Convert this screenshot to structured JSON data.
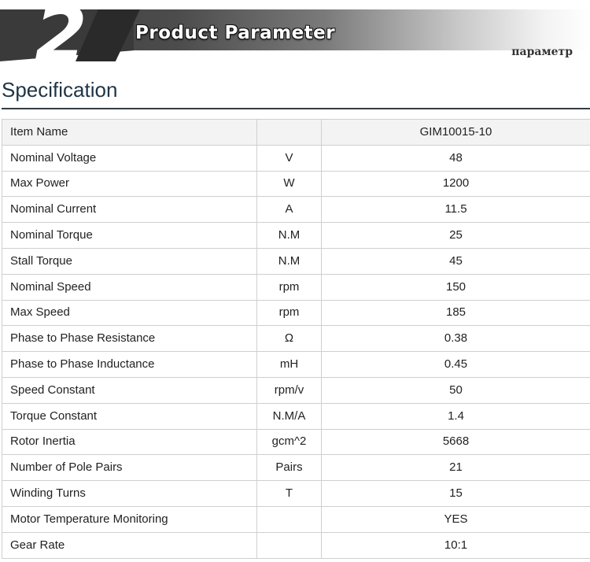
{
  "banner": {
    "number": "2",
    "title": "Product Parameter",
    "subtitle": "параметр"
  },
  "section": {
    "heading": "Specification"
  },
  "table": {
    "header": {
      "name": "Item Name",
      "unit": "",
      "value": "GIM10015-10"
    },
    "rows": [
      {
        "name": "Nominal Voltage",
        "unit": "V",
        "value": "48"
      },
      {
        "name": "Max Power",
        "unit": "W",
        "value": "1200"
      },
      {
        "name": "Nominal Current",
        "unit": "A",
        "value": "11.5"
      },
      {
        "name": "Nominal Torque",
        "unit": "N.M",
        "value": "25"
      },
      {
        "name": "Stall Torque",
        "unit": "N.M",
        "value": "45"
      },
      {
        "name": "Nominal Speed",
        "unit": "rpm",
        "value": "150"
      },
      {
        "name": "Max Speed",
        "unit": "rpm",
        "value": "185"
      },
      {
        "name": "Phase to Phase Resistance",
        "unit": "Ω",
        "value": "0.38"
      },
      {
        "name": "Phase to Phase Inductance",
        "unit": "mH",
        "value": "0.45"
      },
      {
        "name": "Speed Constant",
        "unit": "rpm/v",
        "value": "50"
      },
      {
        "name": "Torque Constant",
        "unit": "N.M/A",
        "value": "1.4"
      },
      {
        "name": "Rotor Inertia",
        "unit": "gcm^2",
        "value": "5668"
      },
      {
        "name": "Number of Pole Pairs",
        "unit": "Pairs",
        "value": "21"
      },
      {
        "name": "Winding Turns",
        "unit": "T",
        "value": "15"
      },
      {
        "name": "Motor Temperature Monitoring",
        "unit": "",
        "value": "YES"
      },
      {
        "name": "Gear Rate",
        "unit": "",
        "value": "10:1"
      }
    ]
  }
}
